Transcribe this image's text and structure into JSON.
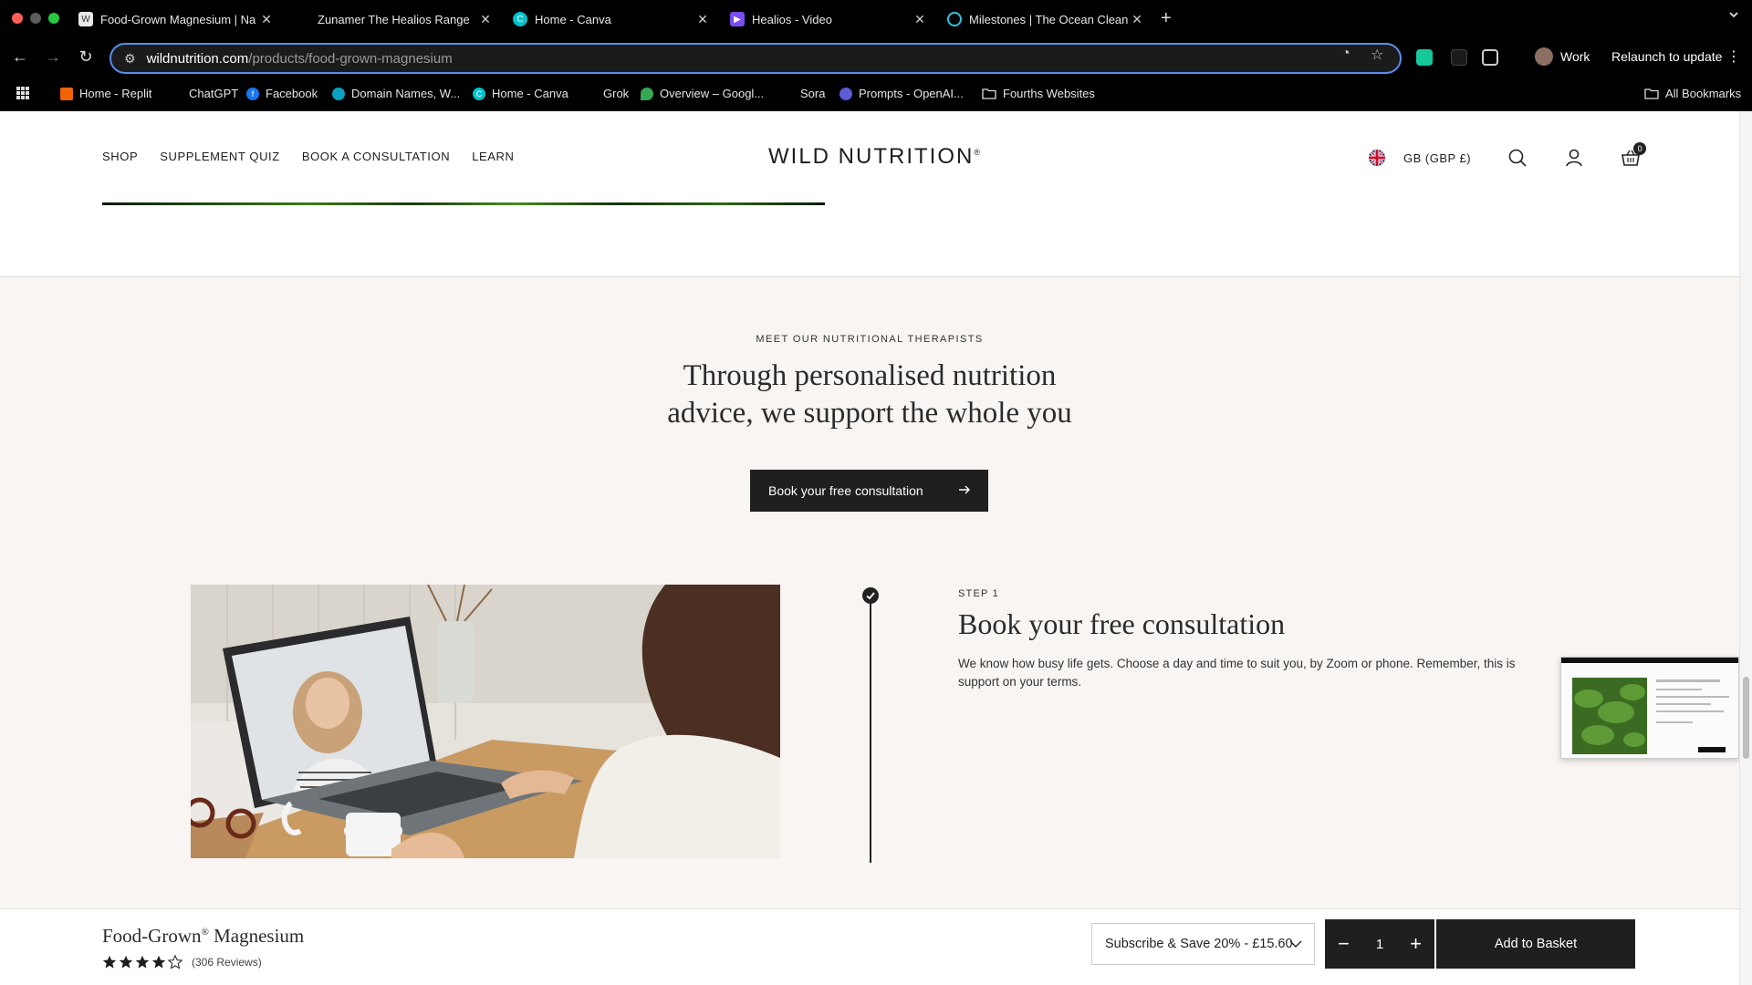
{
  "browser": {
    "tabs": [
      {
        "title": "Food-Grown Magnesium | Na",
        "active": true
      },
      {
        "title": "Zunamer The Healios Range"
      },
      {
        "title": "Home - Canva"
      },
      {
        "title": "Healios - Video"
      },
      {
        "title": "Milestones | The Ocean Clean"
      }
    ],
    "url_host": "wildnutrition.com",
    "url_path": "/products/food-grown-magnesium",
    "profile_name": "Work",
    "relaunch_label": "Relaunch to update",
    "bookmarks": [
      {
        "label": "Home - Replit",
        "color": "#f26207"
      },
      {
        "label": "ChatGPT",
        "color": "#000000"
      },
      {
        "label": "Facebook",
        "color": "#1877f2"
      },
      {
        "label": "Domain Names, W...",
        "color": "#0aa2c0"
      },
      {
        "label": "Home - Canva",
        "color": "#7d2ae8"
      },
      {
        "label": "Grok",
        "color": "#000000"
      },
      {
        "label": "Overview – Googl...",
        "color": "#34a853"
      },
      {
        "label": "Sora",
        "color": "#000000"
      },
      {
        "label": "Prompts - OpenAI...",
        "color": "#5b5bd6"
      },
      {
        "label": "Fourths Websites",
        "color": "folder"
      }
    ],
    "all_bookmarks": "All Bookmarks"
  },
  "header": {
    "nav": [
      "SHOP",
      "SUPPLEMENT QUIZ",
      "BOOK A CONSULTATION",
      "LEARN"
    ],
    "logo": "WILD NUTRITION",
    "logo_mark": "®",
    "locale": "GB (GBP £)",
    "cart_count": "0"
  },
  "therapists": {
    "eyebrow": "MEET OUR NUTRITIONAL THERAPISTS",
    "headline_line1": "Through personalised nutrition",
    "headline_line2": "advice, we support the whole you",
    "cta": "Book your free consultation"
  },
  "step": {
    "label": "STEP 1",
    "title": "Book your free consultation",
    "text": "We know how busy life gets. Choose a day and time to suit you, by Zoom or phone. Remember, this is support on your terms."
  },
  "buybar": {
    "product_name": "Food-Grown",
    "product_mark": "®",
    "product_name_rest": " Magnesium",
    "rating": 4.5,
    "reviews": "(306 Reviews)",
    "subscription": "Subscribe & Save 20% - £15.60",
    "quantity": "1",
    "add_label": "Add to Basket"
  }
}
